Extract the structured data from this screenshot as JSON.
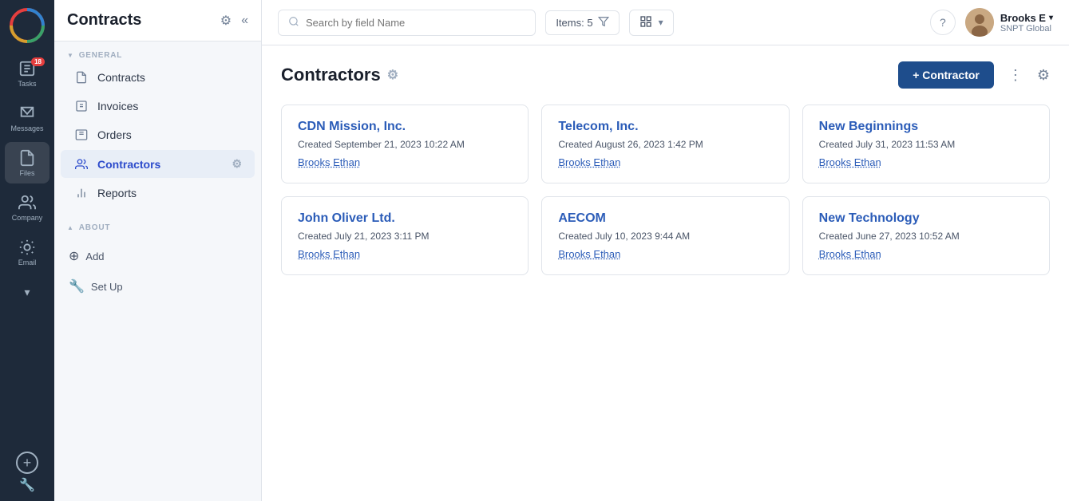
{
  "app": {
    "logo_text": "O"
  },
  "nav": {
    "items": [
      {
        "id": "tasks",
        "label": "Tasks",
        "icon": "📋",
        "badge": "18"
      },
      {
        "id": "messages",
        "label": "Messages",
        "icon": "✉️"
      },
      {
        "id": "files",
        "label": "Files",
        "icon": "📄"
      },
      {
        "id": "company",
        "label": "Company",
        "icon": "👥"
      },
      {
        "id": "email",
        "label": "Email",
        "icon": "＠"
      }
    ],
    "add_label": "+",
    "tool_label": "🔧"
  },
  "sidebar": {
    "title": "Contracts",
    "general_label": "GENERAL",
    "about_label": "ABOUT",
    "items": [
      {
        "id": "contracts",
        "label": "Contracts",
        "icon": "📄"
      },
      {
        "id": "invoices",
        "label": "Invoices",
        "icon": "📓"
      },
      {
        "id": "orders",
        "label": "Orders",
        "icon": "📦"
      },
      {
        "id": "contractors",
        "label": "Contractors",
        "icon": "👥",
        "active": true
      },
      {
        "id": "reports",
        "label": "Reports",
        "icon": "📊"
      }
    ],
    "add_label": "Add",
    "setup_label": "Set Up"
  },
  "topbar": {
    "search_placeholder": "Search by field Name",
    "items_count": "Items: 5",
    "filter_icon": "▽",
    "view_icon": "⊞",
    "help_icon": "?",
    "user": {
      "name": "Brooks E",
      "name_chevron": "▾",
      "company": "SNPT Global"
    }
  },
  "content": {
    "title": "Contractors",
    "add_button": "+ Contractor",
    "more_icon": "⋮",
    "settings_icon": "⚙",
    "cards": [
      {
        "name": "CDN Mission, Inc.",
        "created_label": "Created",
        "created_date": "September 21, 2023 10:22 AM",
        "author": "Brooks Ethan"
      },
      {
        "name": "Telecom, Inc.",
        "created_label": "Created",
        "created_date": "August 26, 2023 1:42 PM",
        "author": "Brooks Ethan"
      },
      {
        "name": "New Beginnings",
        "created_label": "Created",
        "created_date": "July 31, 2023 11:53 AM",
        "author": "Brooks Ethan"
      },
      {
        "name": "John Oliver Ltd.",
        "created_label": "Created",
        "created_date": "July 21, 2023 3:11 PM",
        "author": "Brooks Ethan"
      },
      {
        "name": "AECOM",
        "created_label": "Created",
        "created_date": "July 10, 2023 9:44 AM",
        "author": "Brooks Ethan"
      },
      {
        "name": "New Technology",
        "created_label": "Created",
        "created_date": "June 27, 2023 10:52 AM",
        "author": "Brooks Ethan"
      }
    ]
  }
}
